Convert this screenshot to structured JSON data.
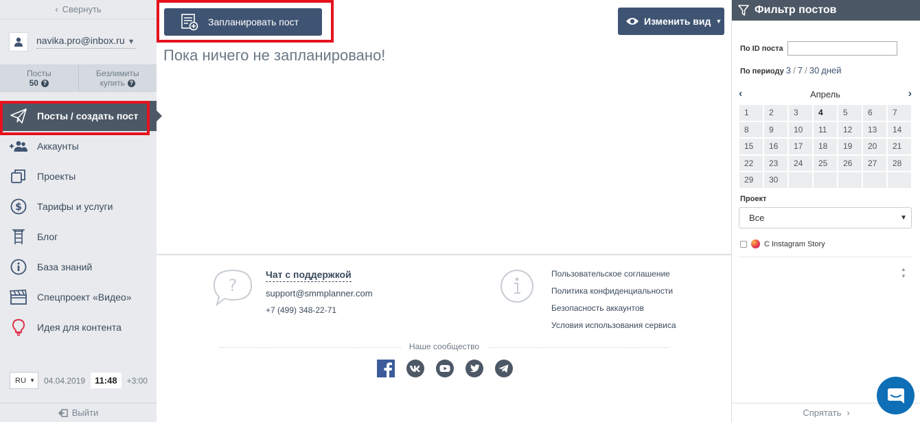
{
  "sidebar": {
    "collapse_label": "Свернуть",
    "user_email": "navika.pro@inbox.ru",
    "stats": {
      "posts_label": "Посты",
      "posts_value": "50",
      "unlimited_label": "Безлимиты",
      "unlimited_action": "купить"
    },
    "nav": [
      {
        "label": "Посты / создать пост",
        "icon": "paper-plane-icon"
      },
      {
        "label": "Аккаунты",
        "icon": "add-users-icon"
      },
      {
        "label": "Проекты",
        "icon": "copy-icon"
      },
      {
        "label": "Тарифы и услуги",
        "icon": "dollar-icon"
      },
      {
        "label": "Блог",
        "icon": "ladder-icon"
      },
      {
        "label": "База знаний",
        "icon": "info-icon"
      },
      {
        "label": "Спецпроект «Видео»",
        "icon": "clapperboard-icon"
      },
      {
        "label": "Идея для контента",
        "icon": "lightbulb-icon"
      }
    ],
    "lang": "RU",
    "date": "04.04.2019",
    "time": "11:48",
    "tz": "+3:00",
    "logout_label": "Выйти"
  },
  "main": {
    "plan_button": "Запланировать пост",
    "view_button": "Изменить вид",
    "empty_message": "Пока ничего не запланировано!"
  },
  "footer": {
    "chat_title": "Чат с поддержкой",
    "email": "support@smmplanner.com",
    "phone": "+7 (499) 348-22-71",
    "links": [
      "Пользовательское соглашение",
      "Политика конфиденциальности",
      "Безопасность аккаунтов",
      "Условия использования сервиса"
    ],
    "community_label": "Наше сообщество",
    "socials": [
      "facebook-icon",
      "vk-icon",
      "youtube-icon",
      "twitter-icon",
      "telegram-icon"
    ]
  },
  "filter": {
    "title": "Фильтр постов",
    "id_label": "По ID поста",
    "period_label": "По периоду",
    "period_options": [
      "3",
      "7",
      "30"
    ],
    "period_unit": "дней",
    "month": "Апрель",
    "days": [
      "1",
      "2",
      "3",
      "4",
      "5",
      "6",
      "7",
      "8",
      "9",
      "10",
      "11",
      "12",
      "13",
      "14",
      "15",
      "16",
      "17",
      "18",
      "19",
      "20",
      "21",
      "22",
      "23",
      "24",
      "25",
      "26",
      "27",
      "28",
      "29",
      "30"
    ],
    "today": "4",
    "project_label": "Проект",
    "project_value": "Все",
    "story_label": "С Instagram Story",
    "hide_label": "Спрятать"
  },
  "colors": {
    "accent": "#3f5473",
    "sidebar_active": "#4d5866",
    "highlight": "#e5121e",
    "chat_bubble": "#0f6fb6"
  }
}
